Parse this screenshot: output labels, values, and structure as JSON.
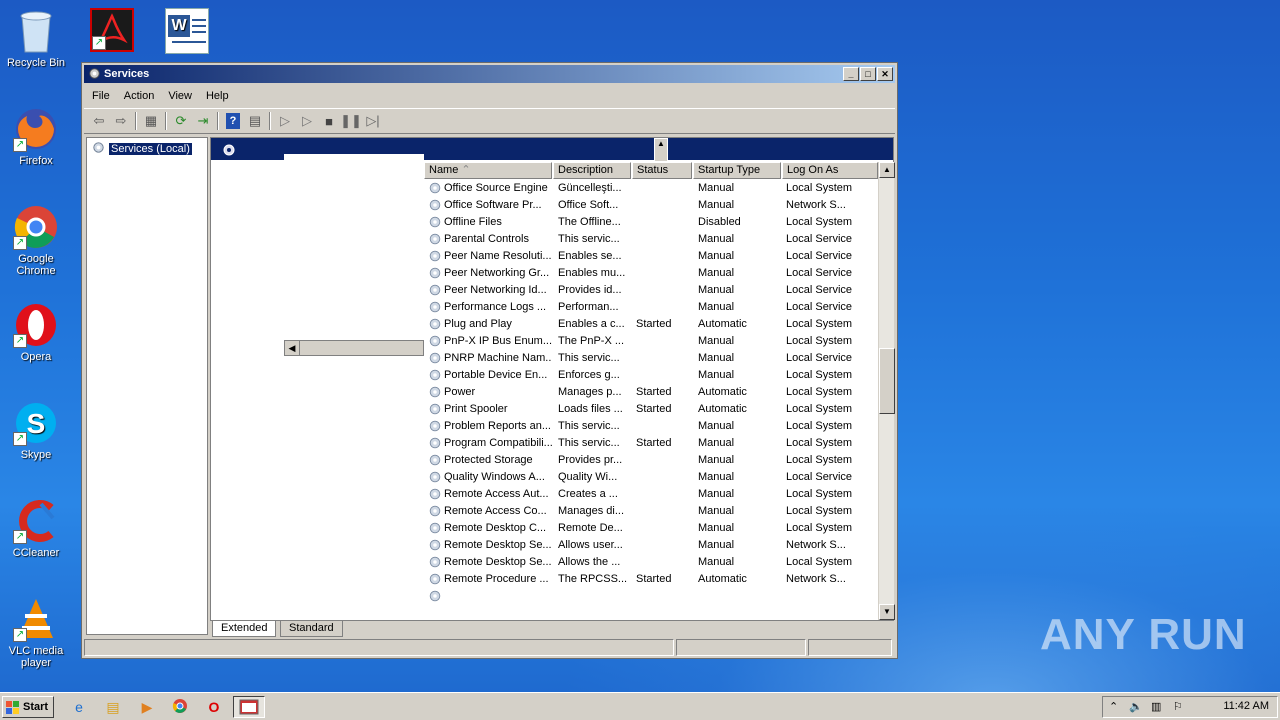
{
  "desktop": {
    "icons": [
      {
        "label": "Recycle Bin",
        "icon": "recycle-bin-icon"
      },
      {
        "label": "Firefox",
        "icon": "firefox-icon"
      },
      {
        "label": "Google Chrome",
        "icon": "chrome-icon"
      },
      {
        "label": "Opera",
        "icon": "opera-icon"
      },
      {
        "label": "Skype",
        "icon": "skype-icon"
      },
      {
        "label": "CCleaner",
        "icon": "ccleaner-icon"
      },
      {
        "label": "VLC media player",
        "icon": "vlc-icon"
      }
    ],
    "top_icons": [
      {
        "icon": "acrobat-reader-icon"
      },
      {
        "icon": "word-document-icon"
      }
    ]
  },
  "window": {
    "title": "Services",
    "menu": [
      "File",
      "Action",
      "View",
      "Help"
    ],
    "tree_root": "Services (Local)",
    "columns": [
      "Name",
      "Description",
      "Status",
      "Startup Type",
      "Log On As"
    ],
    "rows": [
      {
        "name": "Office  Source Engine",
        "desc": "Güncelleşti...",
        "status": "",
        "startup": "Manual",
        "logon": "Local System"
      },
      {
        "name": "Office Software Pr...",
        "desc": "Office Soft...",
        "status": "",
        "startup": "Manual",
        "logon": "Network S..."
      },
      {
        "name": "Offline Files",
        "desc": "The Offline...",
        "status": "",
        "startup": "Disabled",
        "logon": "Local System"
      },
      {
        "name": "Parental Controls",
        "desc": "This servic...",
        "status": "",
        "startup": "Manual",
        "logon": "Local Service"
      },
      {
        "name": "Peer Name Resoluti...",
        "desc": "Enables se...",
        "status": "",
        "startup": "Manual",
        "logon": "Local Service"
      },
      {
        "name": "Peer Networking Gr...",
        "desc": "Enables mu...",
        "status": "",
        "startup": "Manual",
        "logon": "Local Service"
      },
      {
        "name": "Peer Networking Id...",
        "desc": "Provides id...",
        "status": "",
        "startup": "Manual",
        "logon": "Local Service"
      },
      {
        "name": "Performance Logs ...",
        "desc": "Performan...",
        "status": "",
        "startup": "Manual",
        "logon": "Local Service"
      },
      {
        "name": "Plug and Play",
        "desc": "Enables a c...",
        "status": "Started",
        "startup": "Automatic",
        "logon": "Local System"
      },
      {
        "name": "PnP-X IP Bus Enum...",
        "desc": "The PnP-X ...",
        "status": "",
        "startup": "Manual",
        "logon": "Local System"
      },
      {
        "name": "PNRP Machine Nam...",
        "desc": "This servic...",
        "status": "",
        "startup": "Manual",
        "logon": "Local Service"
      },
      {
        "name": "Portable Device En...",
        "desc": "Enforces g...",
        "status": "",
        "startup": "Manual",
        "logon": "Local System"
      },
      {
        "name": "Power",
        "desc": "Manages p...",
        "status": "Started",
        "startup": "Automatic",
        "logon": "Local System"
      },
      {
        "name": "Print Spooler",
        "desc": "Loads files ...",
        "status": "Started",
        "startup": "Automatic",
        "logon": "Local System"
      },
      {
        "name": "Problem Reports an...",
        "desc": "This servic...",
        "status": "",
        "startup": "Manual",
        "logon": "Local System"
      },
      {
        "name": "Program Compatibili...",
        "desc": "This servic...",
        "status": "Started",
        "startup": "Manual",
        "logon": "Local System"
      },
      {
        "name": "Protected Storage",
        "desc": "Provides pr...",
        "status": "",
        "startup": "Manual",
        "logon": "Local System"
      },
      {
        "name": "Quality Windows A...",
        "desc": "Quality Wi...",
        "status": "",
        "startup": "Manual",
        "logon": "Local Service"
      },
      {
        "name": "Remote Access Aut...",
        "desc": "Creates a ...",
        "status": "",
        "startup": "Manual",
        "logon": "Local System"
      },
      {
        "name": "Remote Access Co...",
        "desc": "Manages di...",
        "status": "",
        "startup": "Manual",
        "logon": "Local System"
      },
      {
        "name": "Remote Desktop C...",
        "desc": "Remote De...",
        "status": "",
        "startup": "Manual",
        "logon": "Local System"
      },
      {
        "name": "Remote Desktop Se...",
        "desc": "Allows user...",
        "status": "",
        "startup": "Manual",
        "logon": "Network S..."
      },
      {
        "name": "Remote Desktop Se...",
        "desc": "Allows the ...",
        "status": "",
        "startup": "Manual",
        "logon": "Local System"
      },
      {
        "name": "Remote Procedure ...",
        "desc": "The RPCSS...",
        "status": "Started",
        "startup": "Automatic",
        "logon": "Network S..."
      },
      {
        "name": "",
        "desc": "",
        "status": "",
        "startup": "",
        "logon": ""
      }
    ],
    "tabs": [
      "Extended",
      "Standard"
    ]
  },
  "taskbar": {
    "start_label": "Start",
    "clock": "11:42 AM"
  },
  "watermark": "ANY RUN"
}
